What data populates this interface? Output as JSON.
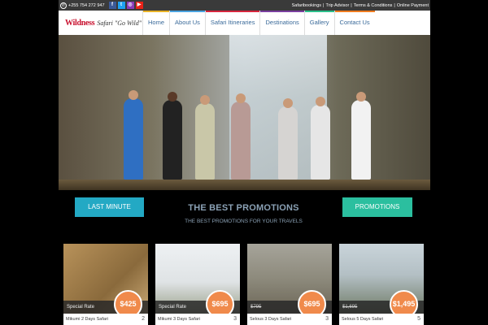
{
  "topbar": {
    "phone": "+255 754 272 947",
    "links": [
      "Safaribookings",
      "Trip Advisor",
      "Terms & Conditions",
      "Online Payment"
    ]
  },
  "header": {
    "logo_text": "Wildness",
    "logo_sub": "Safari \"Go Wild\"",
    "nav": [
      "Home",
      "About Us",
      "Safari Itineraries",
      "Destinations",
      "Gallery",
      "Contact Us"
    ]
  },
  "promos": {
    "left_button": "LAST MINUTE",
    "right_button": "PROMOTIONS",
    "title": "THE BEST PROMOTIONS",
    "subtitle": "THE BEST PROMOTIONS FOR YOUR TRAVELS"
  },
  "cards": [
    {
      "rate_label": "Special Rate",
      "old_price": "",
      "price": "$425",
      "caption": "Mikumi 2 Days Safari",
      "num": "2"
    },
    {
      "rate_label": "Special Rate",
      "old_price": "",
      "price": "$695",
      "caption": "Mikumi 3 Days Safari",
      "num": "3"
    },
    {
      "rate_label": "",
      "old_price": "$795",
      "price": "$695",
      "caption": "Selous 3 Days Safari",
      "num": "3"
    },
    {
      "rate_label": "",
      "old_price": "$1,695",
      "price": "$1,495",
      "caption": "Selous 5 Days Safari",
      "num": "5"
    }
  ],
  "colors": {
    "topbar": "#3a3a3a",
    "nav_text": "#3a6a9a",
    "btn_left": "#23a9c4",
    "btn_right": "#2bbf9f",
    "price_badge": "#f08a4b"
  }
}
